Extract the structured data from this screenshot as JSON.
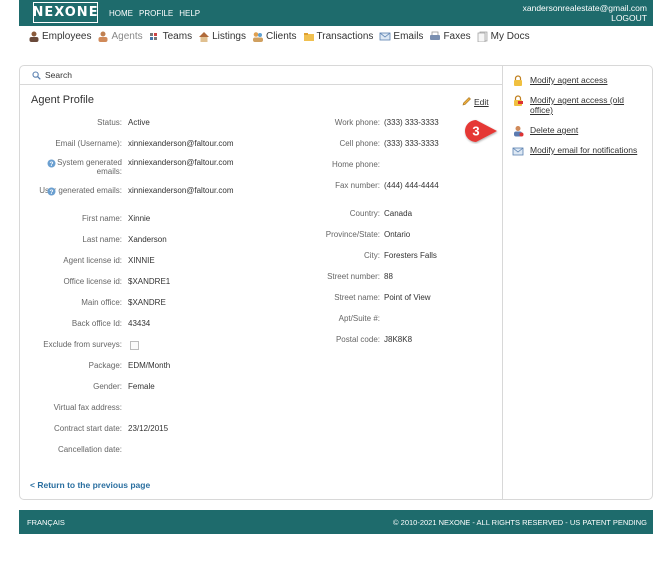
{
  "header": {
    "logo": "NEXONE",
    "nav": [
      "HOME",
      "PROFILE",
      "HELP"
    ],
    "account_email": "xandersonrealestate@gmail.com",
    "logout": "LOGOUT"
  },
  "mainnav": [
    {
      "label": "Employees",
      "icon": "employees-icon"
    },
    {
      "label": "Agents",
      "icon": "agents-icon",
      "active": true
    },
    {
      "label": "Teams",
      "icon": "teams-icon"
    },
    {
      "label": "Listings",
      "icon": "listings-icon"
    },
    {
      "label": "Clients",
      "icon": "clients-icon"
    },
    {
      "label": "Transactions",
      "icon": "transactions-icon"
    },
    {
      "label": "Emails",
      "icon": "emails-icon"
    },
    {
      "label": "Faxes",
      "icon": "faxes-icon"
    },
    {
      "label": "My Docs",
      "icon": "docs-icon"
    }
  ],
  "search": {
    "label": "Search"
  },
  "profile": {
    "title": "Agent Profile",
    "edit": "Edit",
    "left": [
      {
        "label": "Status:",
        "value": "Active"
      },
      {
        "label": "Email (Username):",
        "value": "xinniexanderson@faltour.com"
      },
      {
        "label": "System generated emails:",
        "value": "xinniexanderson@faltour.com",
        "help": true
      },
      {
        "label": "User generated emails:",
        "value": "xinniexanderson@faltour.com",
        "help": true
      },
      {
        "label": "First name:",
        "value": "Xinnie"
      },
      {
        "label": "Last name:",
        "value": "Xanderson"
      },
      {
        "label": "Agent license id:",
        "value": "XINNIE"
      },
      {
        "label": "Office license id:",
        "value": "$XANDRE1"
      },
      {
        "label": "Main office:",
        "value": "$XANDRE"
      },
      {
        "label": "Back office Id:",
        "value": "43434"
      },
      {
        "label": "Exclude from surveys:",
        "value": ""
      },
      {
        "label": "Package:",
        "value": "EDM/Month"
      },
      {
        "label": "Gender:",
        "value": "Female"
      },
      {
        "label": "Virtual fax address:",
        "value": ""
      },
      {
        "label": "Contract start date:",
        "value": "23/12/2015"
      },
      {
        "label": "Cancellation date:",
        "value": ""
      }
    ],
    "right": [
      {
        "label": "Work phone:",
        "value": "(333) 333-3333"
      },
      {
        "label": "Cell phone:",
        "value": "(333) 333-3333"
      },
      {
        "label": "Home phone:",
        "value": ""
      },
      {
        "label": "Fax number:",
        "value": "(444) 444-4444"
      },
      {
        "label": "Country:",
        "value": "Canada"
      },
      {
        "label": "Province/State:",
        "value": "Ontario"
      },
      {
        "label": "City:",
        "value": "Foresters Falls"
      },
      {
        "label": "Street number:",
        "value": "88"
      },
      {
        "label": "Street name:",
        "value": "Point of View"
      },
      {
        "label": "Apt/Suite #:",
        "value": ""
      },
      {
        "label": "Postal code:",
        "value": "J8K8K8"
      }
    ],
    "back_link": "< Return to the previous page"
  },
  "actions": [
    {
      "label": "Modify agent access",
      "icon": "lock-icon"
    },
    {
      "label": "Modify agent access (old office)",
      "icon": "lock-edit-icon"
    },
    {
      "label": "Delete agent",
      "icon": "delete-user-icon"
    },
    {
      "label": "Modify email for notifications",
      "icon": "envelope-icon"
    }
  ],
  "step_badge": "3",
  "footer": {
    "language": "FRANÇAIS",
    "copyright": "© 2010-2021 NEXONE - ALL RIGHTS RESERVED - US PATENT PENDING"
  },
  "colors": {
    "brand": "#1e6b6c",
    "link": "#2a6fa0",
    "badge": "#e53935"
  }
}
